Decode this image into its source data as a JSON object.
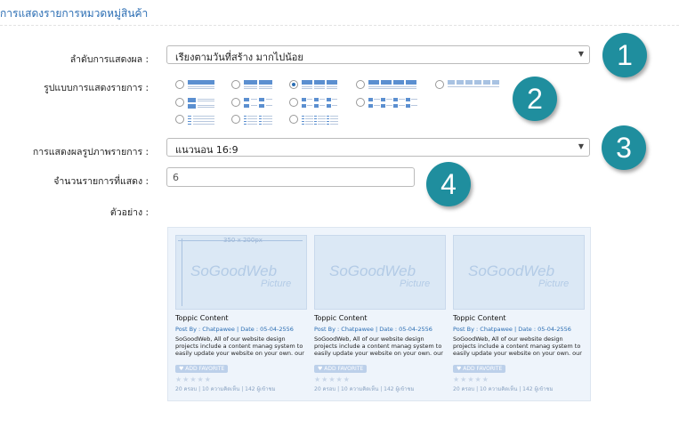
{
  "page_title": "การแสดงรายการหมวดหมู่สินค้า",
  "form": {
    "sort_label": "ลำดับการแสดงผล :",
    "sort_value": "เรียงตามวันที่สร้าง มากไปน้อย",
    "layout_label": "รูปแบบการแสดงรายการ :",
    "image_label": "การแสดงผลรูปภาพรายการ :",
    "image_value": "แนวนอน 16:9",
    "count_label": "จำนวนรายการที่แสดง :",
    "count_value": "6",
    "example_label": "ตัวอย่าง :"
  },
  "layout_options": {
    "selected": "layout-3",
    "items": [
      "layout-1",
      "layout-2",
      "layout-3",
      "layout-4",
      "layout-5",
      "layout-6",
      "layout-7",
      "layout-8",
      "layout-9",
      "layout-10",
      "layout-11",
      "layout-12"
    ]
  },
  "badges": [
    "1",
    "2",
    "3",
    "4"
  ],
  "preview": {
    "dimension_label": "350 x 200px",
    "logo_text": "SoGoodWeb",
    "logo_sub": "Picture",
    "cards": [
      {
        "title": "Toppic Content",
        "meta": "Post By : Chatpawee  |  Date : 05-04-2556",
        "desc": "SoGoodWeb, All of our website design projects include a content manag system to easily update your website on your own. our web designers can",
        "fav": "ADD FAVORITE",
        "stars": "★★★★★",
        "stats": "20 ครอบ  |  10 ความคิดเห็น  |  142 ผู้เข้าชม"
      },
      {
        "title": "Toppic Content",
        "meta": "Post By : Chatpawee  |  Date : 05-04-2556",
        "desc": "SoGoodWeb, All of our website design projects include a content manag system to easily update your website on your own. our web designers can",
        "fav": "ADD FAVORITE",
        "stars": "★★★★★",
        "stats": "20 ครอบ  |  10 ความคิดเห็น  |  142 ผู้เข้าชม"
      },
      {
        "title": "Toppic Content",
        "meta": "Post By : Chatpawee  |  Date : 05-04-2556",
        "desc": "SoGoodWeb, All of our website design projects include a content manag system to easily update your website on your own. our web designers can",
        "fav": "ADD FAVORITE",
        "stars": "★★★★★",
        "stats": "20 ครอบ  |  10 ความคิดเห็น  |  142 ผู้เข้าชม"
      }
    ]
  },
  "colors": {
    "badge": "#1f8e9e",
    "link": "#2a6db3",
    "preview_bg": "#eef4fb"
  }
}
